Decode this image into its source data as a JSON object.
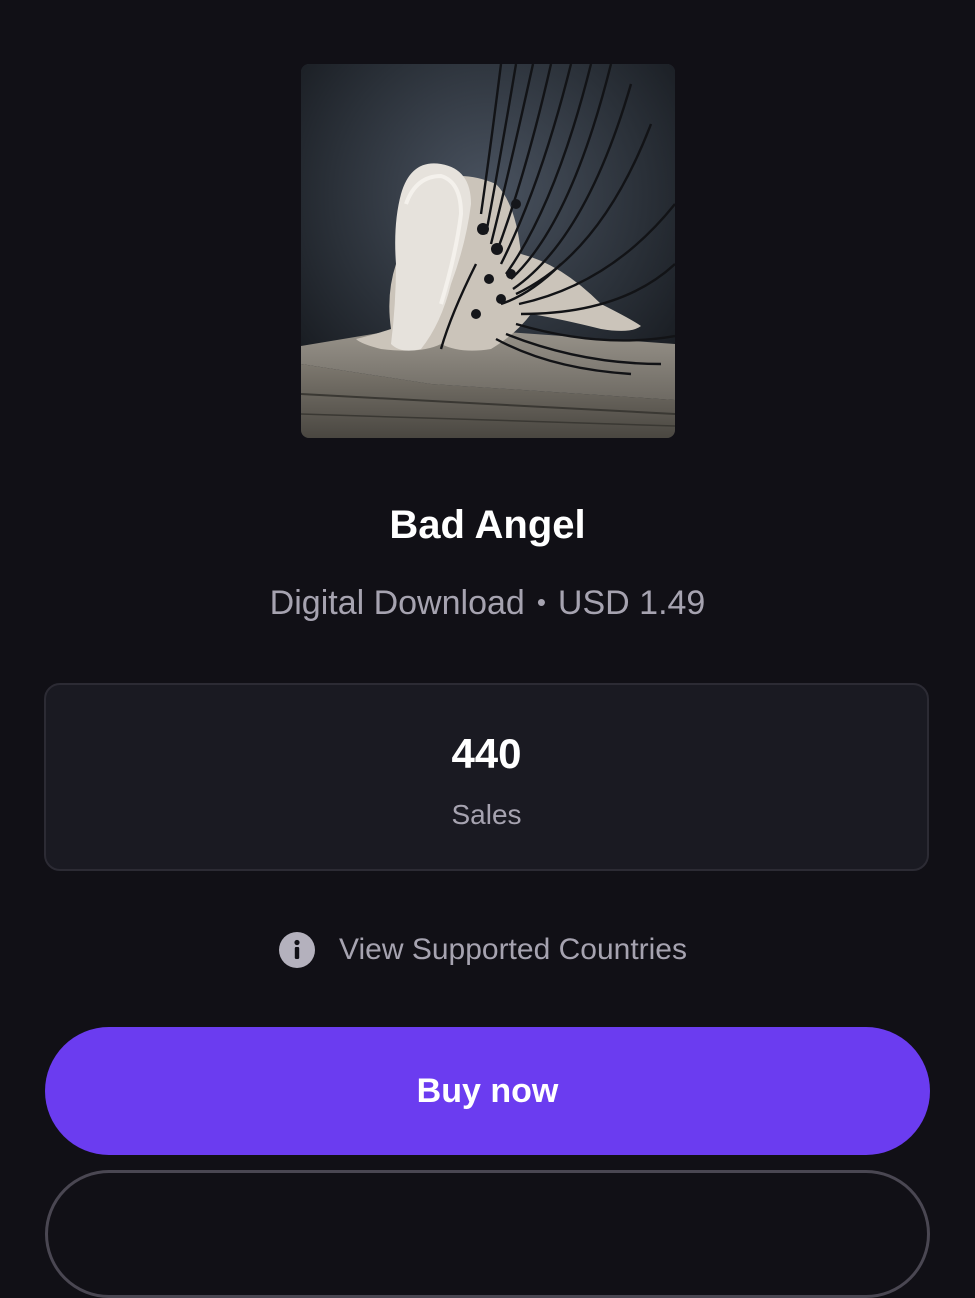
{
  "product": {
    "title": "Bad Angel",
    "type": "Digital Download",
    "separator": "•",
    "price": "USD 1.49"
  },
  "stats": {
    "value": "440",
    "label": "Sales"
  },
  "countries_link": {
    "icon": "info-icon",
    "label": "View Supported Countries"
  },
  "buy_button": {
    "label": "Buy now"
  },
  "colors": {
    "background": "#111016",
    "accent": "#6b3cf0",
    "muted_text": "#a6a3b0",
    "card_bg": "#1a1a22"
  }
}
